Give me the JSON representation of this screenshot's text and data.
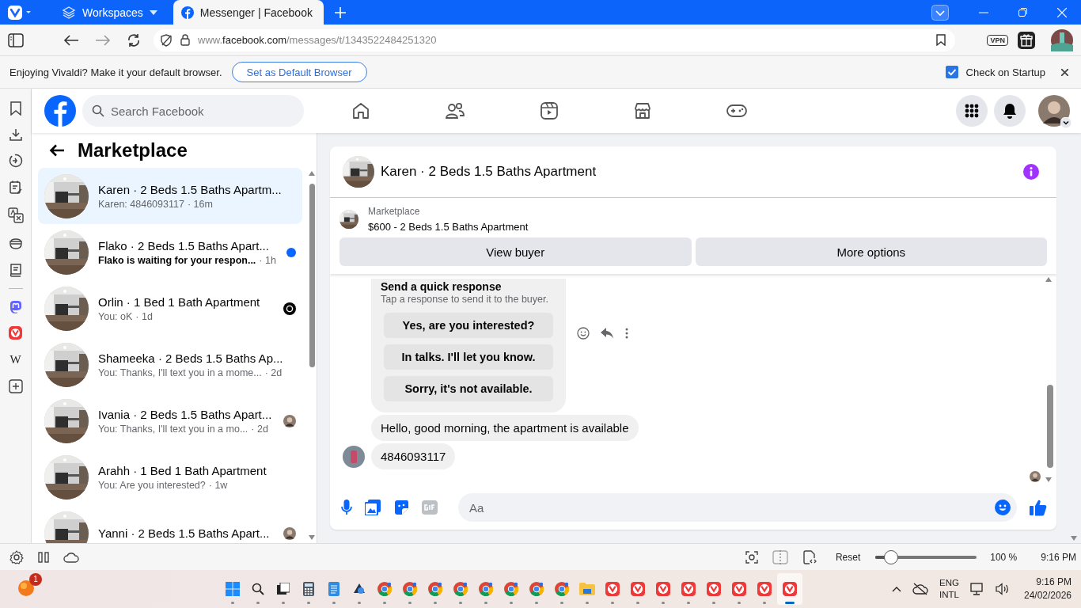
{
  "browser": {
    "tabs": [
      {
        "kind": "workspaces",
        "label": "Workspaces",
        "selected": false
      },
      {
        "kind": "page",
        "label": "Messenger | Facebook",
        "selected": true
      }
    ],
    "url": {
      "prefix": "www.",
      "host": "facebook.com",
      "path": "/messages/t/1343522484251320"
    },
    "vpn": "VPN"
  },
  "notification": {
    "text": "Enjoying Vivaldi? Make it your default browser.",
    "button": "Set as Default Browser",
    "checkbox_label": "Check on Startup",
    "checked": true
  },
  "side_panel": [
    {
      "kind": "bookmarks"
    },
    {
      "kind": "downloads"
    },
    {
      "kind": "history"
    },
    {
      "kind": "notes"
    },
    {
      "kind": "translate"
    },
    {
      "kind": "reading"
    },
    {
      "kind": "book"
    },
    {
      "kind": "divider"
    },
    {
      "kind": "mastodon"
    },
    {
      "kind": "vivaldi"
    },
    {
      "kind": "wikipedia",
      "glyph": "W"
    },
    {
      "kind": "add"
    }
  ],
  "facebook": {
    "search": {
      "placeholder": "Search Facebook"
    },
    "inbox": {
      "title": "Marketplace",
      "conversations": [
        {
          "kind": "plain",
          "title": "Karen · 2 Beds 1.5 Baths Apartm...",
          "preview": "Karen: 4846093117",
          "time": "· 16m",
          "selected": true
        },
        {
          "kind": "unread",
          "title": "Flako · 2 Beds 1.5 Baths Apart...",
          "preview": "Flako is waiting for your respon...",
          "time": "· 1h",
          "selected": false
        },
        {
          "kind": "seen",
          "title": "Orlin · 1 Bed 1 Bath Apartment",
          "preview": "You: oK",
          "time": "· 1d",
          "selected": false
        },
        {
          "kind": "plain",
          "title": "Shameeka · 2 Beds 1.5 Baths Ap...",
          "preview": "You: Thanks, I'll text you in a mome...",
          "time": "· 2d",
          "selected": false
        },
        {
          "kind": "seen-avatar",
          "title": "Ivania · 2 Beds 1.5 Baths Apart...",
          "preview": "You: Thanks, I'll text you in a mo...",
          "time": "· 2d",
          "selected": false
        },
        {
          "kind": "plain",
          "title": "Arahh · 1 Bed 1 Bath Apartment",
          "preview": "You: Are you interested?",
          "time": "· 1w",
          "selected": false
        },
        {
          "kind": "seen-avatar",
          "title": "Yanni · 2 Beds 1.5 Baths Apart...",
          "selected": false
        }
      ]
    },
    "chat": {
      "title": "Karen · 2 Beds 1.5 Baths Apartment",
      "listing": {
        "label": "Marketplace",
        "name": "$600 - 2 Beds 1.5 Baths Apartment",
        "buttons": [
          "View buyer",
          "More options"
        ]
      },
      "quick_response": {
        "title": "Send a quick response",
        "subtitle": "Tap a response to send it to the buyer.",
        "options": [
          "Yes, are you interested?",
          "In talks. I'll let you know.",
          "Sorry, it's not available."
        ]
      },
      "messages": [
        {
          "text": "Hello, good morning, the apartment is available",
          "avatar": false
        },
        {
          "text": "4846093117",
          "avatar": true
        }
      ],
      "composer": {
        "placeholder": "Aa"
      }
    }
  },
  "status_bar": {
    "reset": "Reset",
    "zoom": {
      "level": 0.2
    },
    "zoom_reading": "100 %",
    "time": "9:16 PM"
  },
  "taskbar": {
    "badge": "1",
    "apps": [
      {
        "kind": "start",
        "selected": false
      },
      {
        "kind": "search",
        "selected": false
      },
      {
        "kind": "taskview",
        "selected": false
      },
      {
        "kind": "calculator",
        "selected": false
      },
      {
        "kind": "notepad",
        "selected": false
      },
      {
        "kind": "app",
        "selected": false
      },
      {
        "kind": "chrome",
        "selected": false
      },
      {
        "kind": "chrome",
        "selected": false
      },
      {
        "kind": "chrome",
        "selected": false
      },
      {
        "kind": "chrome",
        "selected": false
      },
      {
        "kind": "chrome",
        "selected": false
      },
      {
        "kind": "chrome",
        "selected": false
      },
      {
        "kind": "chrome",
        "selected": false
      },
      {
        "kind": "chrome",
        "selected": false
      },
      {
        "kind": "explorer",
        "selected": false
      },
      {
        "kind": "vivaldi",
        "selected": false
      },
      {
        "kind": "vivaldi",
        "selected": false
      },
      {
        "kind": "vivaldi",
        "selected": false
      },
      {
        "kind": "vivaldi",
        "selected": false
      },
      {
        "kind": "vivaldi",
        "selected": false
      },
      {
        "kind": "vivaldi",
        "selected": false
      },
      {
        "kind": "vivaldi",
        "selected": false
      },
      {
        "kind": "vivaldi",
        "selected": true
      }
    ],
    "language": [
      "ENG",
      "INTL"
    ],
    "time": "9:16 PM",
    "date": "24/02/2026"
  }
}
